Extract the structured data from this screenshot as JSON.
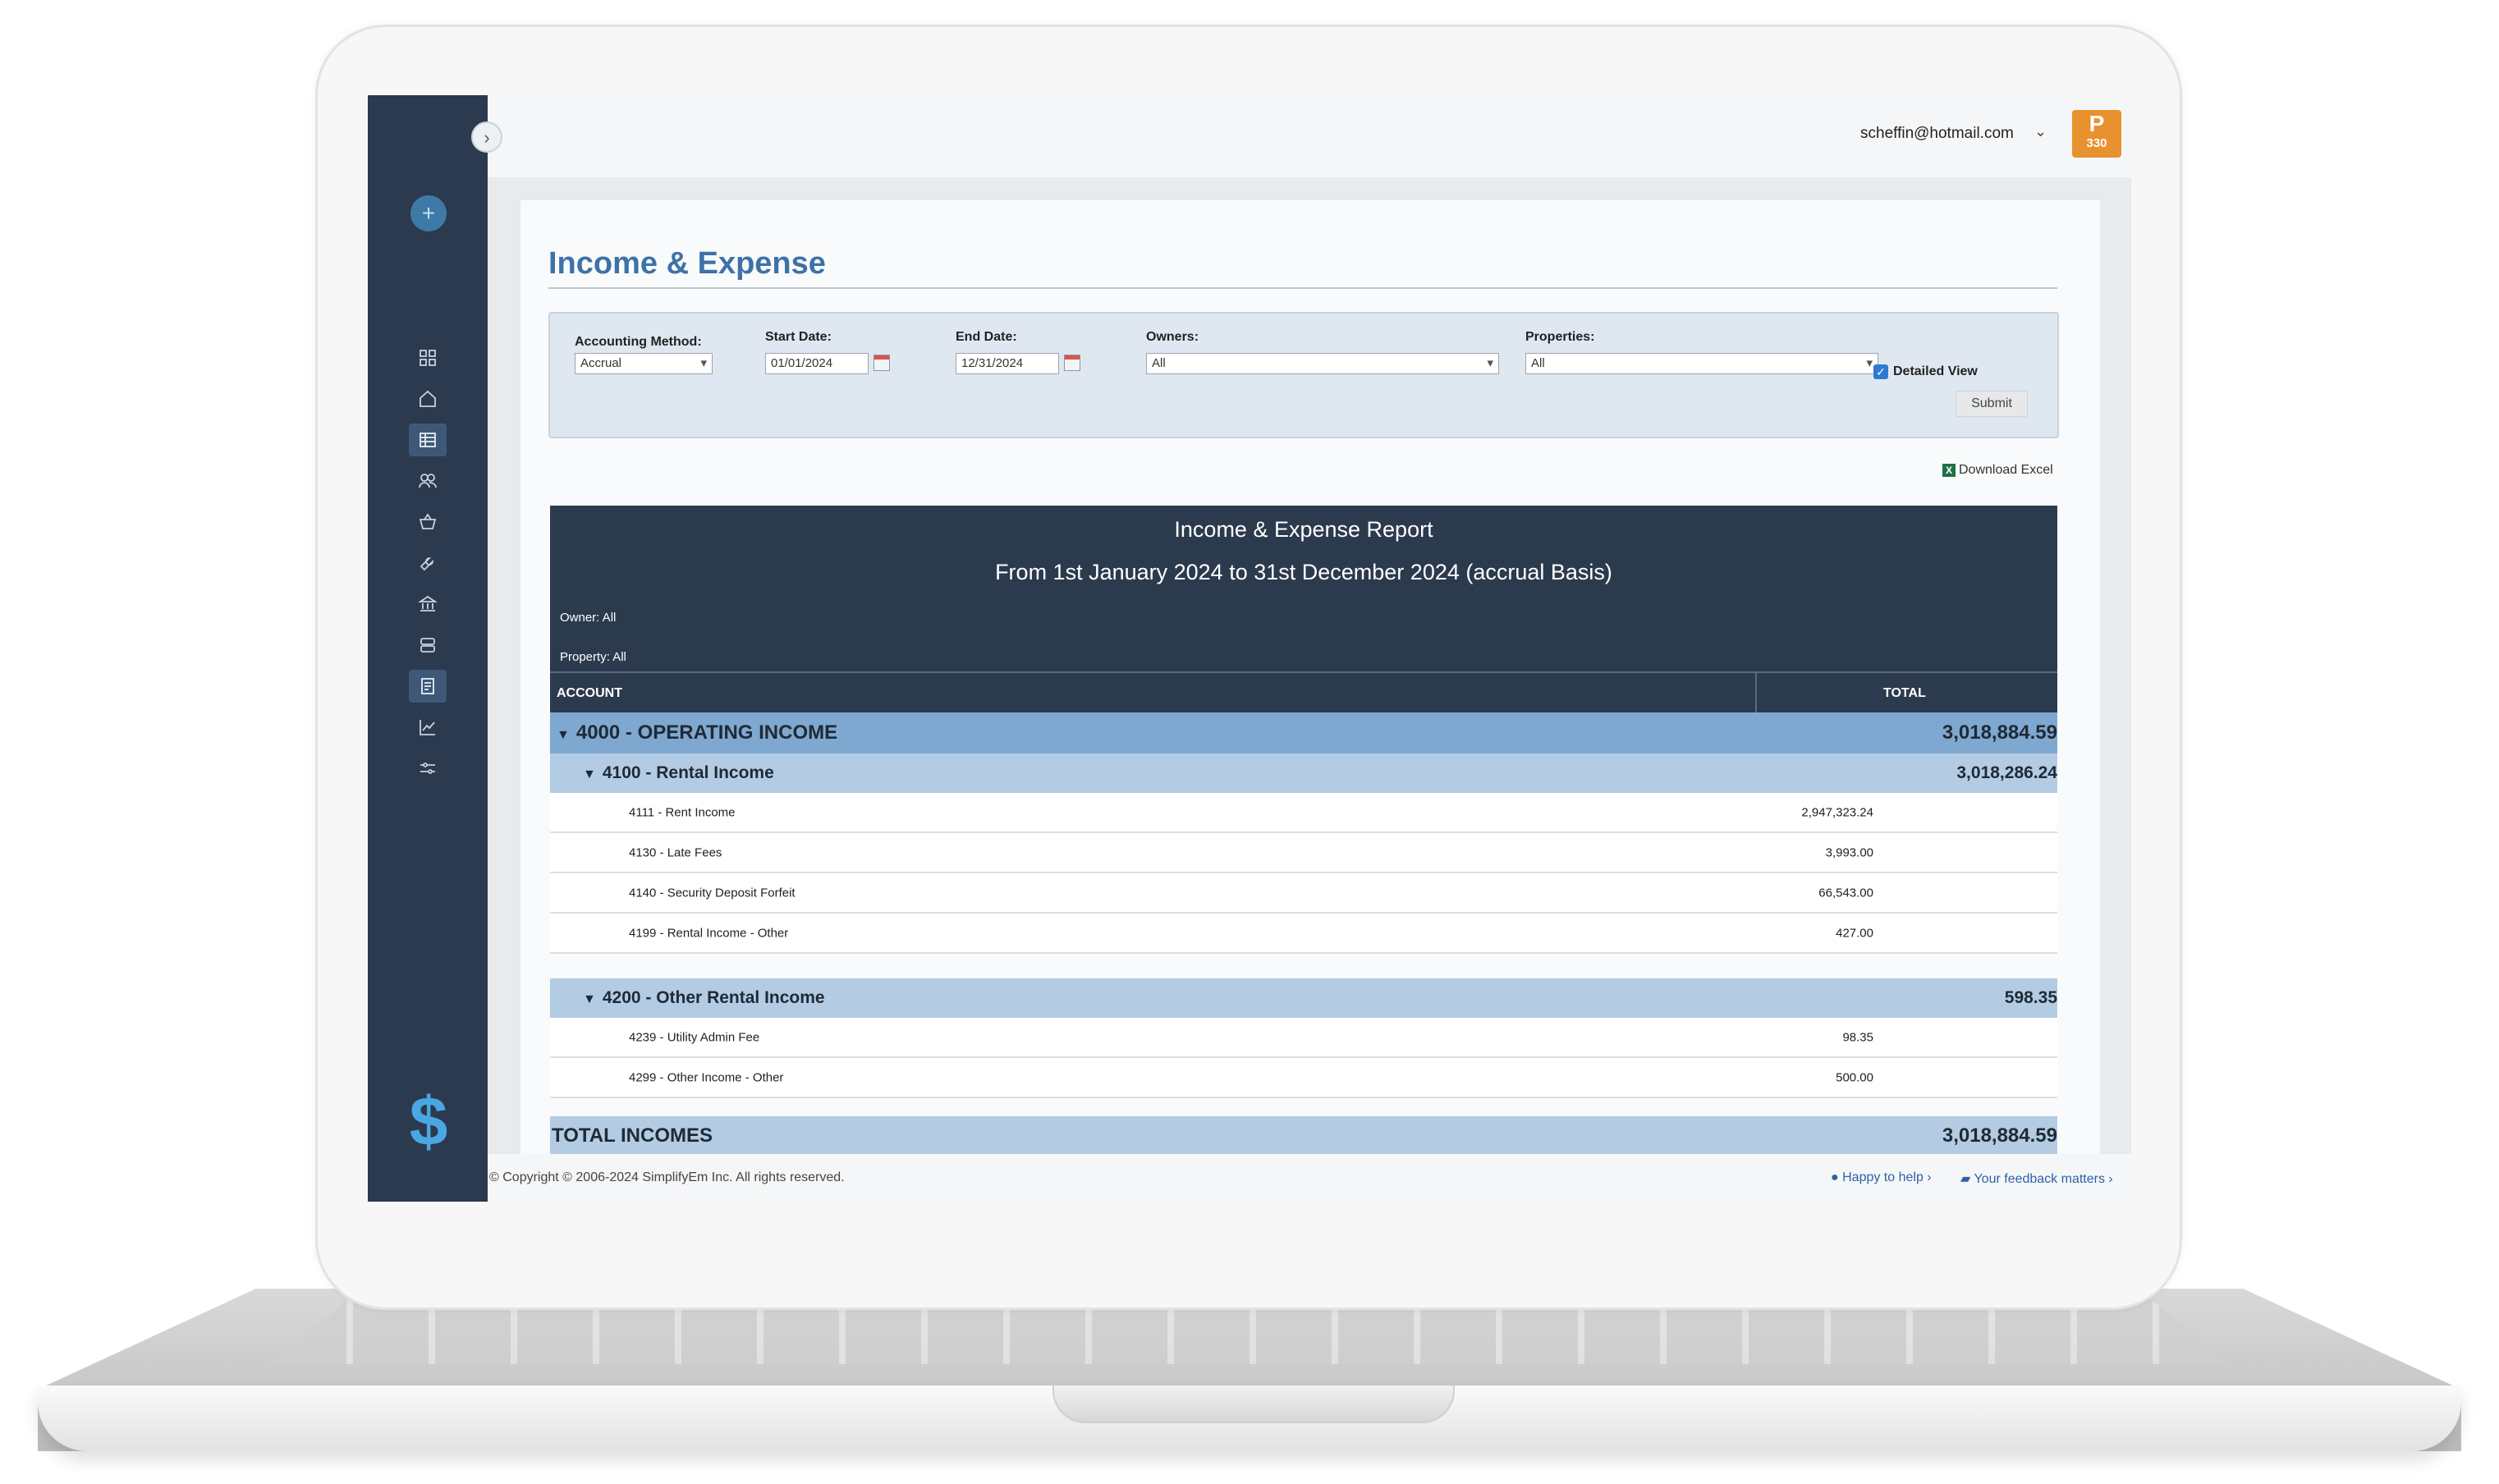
{
  "header": {
    "user_email": "scheffin@hotmail.com",
    "plan_badge": {
      "letter": "P",
      "number": "330"
    }
  },
  "sidebar": {
    "icons": [
      "dashboard-icon",
      "home-icon",
      "table-icon",
      "people-icon",
      "basket-icon",
      "wrench-icon",
      "bank-icon",
      "database-icon",
      "document-icon",
      "chart-icon",
      "sliders-icon"
    ],
    "active": [
      "table-icon",
      "document-icon"
    ]
  },
  "page": {
    "title": "Income & Expense"
  },
  "filters": {
    "accounting_method_label": "Accounting Method:",
    "accounting_method_value": "Accrual",
    "start_date_label": "Start Date:",
    "start_date_value": "01/01/2024",
    "end_date_label": "End Date:",
    "end_date_value": "12/31/2024",
    "owners_label": "Owners:",
    "owners_value": "All",
    "properties_label": "Properties:",
    "properties_value": "All",
    "detailed_view_label": "Detailed View",
    "detailed_view_checked": true,
    "submit_label": "Submit"
  },
  "download_excel_label": "Download Excel",
  "report": {
    "title": "Income & Expense Report",
    "range": "From 1st January 2024 to 31st December 2024 (accrual Basis)",
    "owner_line": "Owner: All",
    "property_line": "Property: All",
    "col_account": "ACCOUNT",
    "col_total": "TOTAL",
    "group_operating": {
      "name": "4000 - OPERATING INCOME",
      "total": "3,018,884.59"
    },
    "group_rental": {
      "name": "4100 - Rental Income",
      "total": "3,018,286.24"
    },
    "rental_rows": [
      {
        "name": "4111 - Rent Income",
        "amount": "2,947,323.24"
      },
      {
        "name": "4130 - Late Fees",
        "amount": "3,993.00"
      },
      {
        "name": "4140 - Security Deposit Forfeit",
        "amount": "66,543.00"
      },
      {
        "name": "4199 - Rental Income - Other",
        "amount": "427.00"
      }
    ],
    "group_other_rental": {
      "name": "4200 - Other Rental Income",
      "total": "598.35"
    },
    "other_rows": [
      {
        "name": "4239 - Utility Admin Fee",
        "amount": "98.35"
      },
      {
        "name": "4299 - Other Income - Other",
        "amount": "500.00"
      }
    ],
    "total_incomes": {
      "name": "TOTAL INCOMES",
      "total": "3,018,884.59"
    }
  },
  "footer": {
    "copyright": "© Copyright © 2006-2024 SimplifyEm Inc. All rights reserved.",
    "help": "Happy to help",
    "feedback": "Your feedback matters"
  }
}
